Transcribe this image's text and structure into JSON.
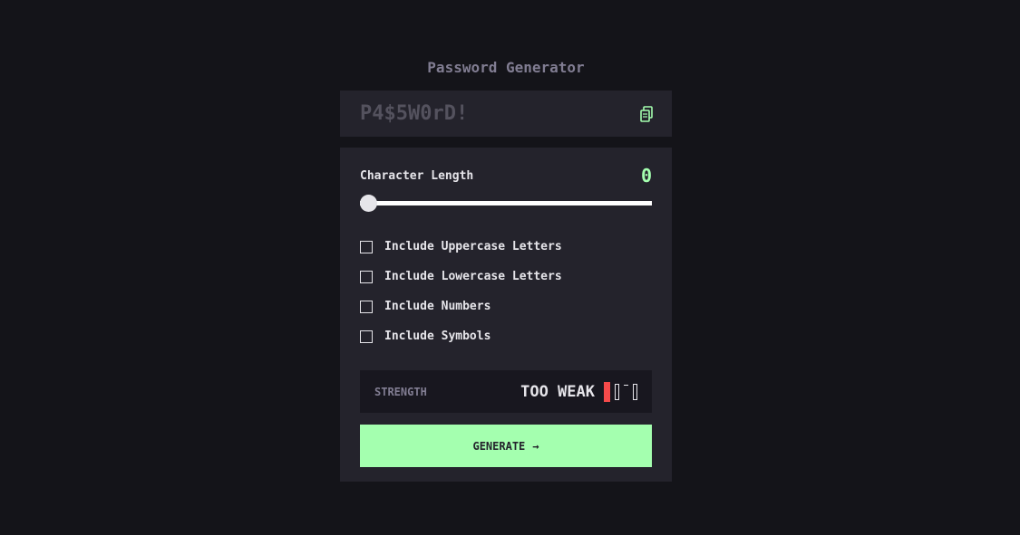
{
  "header": {
    "title": "Password Generator"
  },
  "output": {
    "password_placeholder": "P4$5W0rD!",
    "copy_icon": "copy-icon"
  },
  "settings": {
    "length_label": "Character Length",
    "length_value": "0",
    "slider_level": 0,
    "options": [
      {
        "label": "Include Uppercase Letters",
        "checked": false
      },
      {
        "label": "Include Lowercase Letters",
        "checked": false
      },
      {
        "label": "Include Numbers",
        "checked": false
      },
      {
        "label": "Include Symbols",
        "checked": false
      }
    ]
  },
  "strength": {
    "label": "STRENGTH",
    "value": "TOO WEAK",
    "filled_bars": 1,
    "total_bars": 4
  },
  "actions": {
    "generate_label": "GENERATE",
    "generate_icon": "arrow-right-icon"
  },
  "colors": {
    "accent": "#A4FFAF",
    "danger": "#F64A4A",
    "background": "#141419",
    "panel": "#24232C"
  }
}
